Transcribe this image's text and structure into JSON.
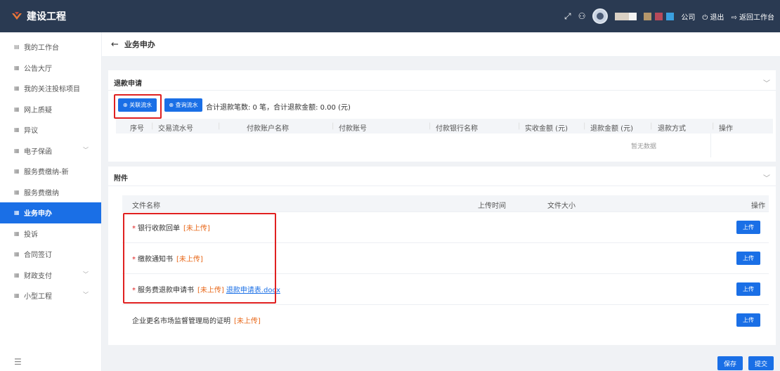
{
  "app": {
    "title": "建设工程"
  },
  "header": {
    "company": "公司",
    "logout": "退出",
    "back_to_workbench": "返回工作台",
    "colors": {
      "bar": "#2a3a52",
      "accent": "#1a6fe6"
    }
  },
  "sidebar": {
    "items": [
      {
        "label": "我的工作台",
        "icon": "workbench-icon"
      },
      {
        "label": "公告大厅",
        "icon": "grid-icon"
      },
      {
        "label": "我的关注投标项目",
        "icon": "grid-icon"
      },
      {
        "label": "网上质疑",
        "icon": "grid-icon"
      },
      {
        "label": "异议",
        "icon": "grid-icon"
      },
      {
        "label": "电子保函",
        "icon": "grid-icon"
      },
      {
        "label": "服务费缴纳-新",
        "icon": "grid-icon"
      },
      {
        "label": "服务费缴纳",
        "icon": "grid-icon"
      },
      {
        "label": "业务申办",
        "icon": "grid-icon"
      },
      {
        "label": "投诉",
        "icon": "grid-icon"
      },
      {
        "label": "合同签订",
        "icon": "grid-icon"
      },
      {
        "label": "财政支付",
        "icon": "grid-icon"
      },
      {
        "label": "小型工程",
        "icon": "grid-icon"
      }
    ]
  },
  "breadcrumb": {
    "title": "业务申办"
  },
  "refund": {
    "title": "退款申请",
    "link_button": "关联流水",
    "query_button": "查询流水",
    "summary": "合计退款笔数: 0 笔，合计退款金额: 0.00 (元)",
    "columns": [
      "序号",
      "交易流水号",
      "付款账户名称",
      "付款账号",
      "付款银行名称",
      "实收金额 (元)",
      "退款金额 (元)",
      "退款方式",
      "操作"
    ],
    "empty": "暂无数据"
  },
  "attachments": {
    "title": "附件",
    "columns": {
      "name": "文件名称",
      "upload_time": "上传时间",
      "size": "文件大小",
      "action": "操作"
    },
    "rows": [
      {
        "required": "*",
        "name": "银行收款回单",
        "status": "[未上传]",
        "file": "",
        "button": "上传"
      },
      {
        "required": "*",
        "name": "缴款通知书",
        "status": "[未上传]",
        "file": "",
        "button": "上传"
      },
      {
        "required": "*",
        "name": "服务费退款申请书",
        "status": "[未上传]",
        "file": "退款申请表.docx",
        "button": "上传"
      },
      {
        "required": "",
        "name": "企业更名市场监督管理局的证明",
        "status": "[未上传]",
        "file": "",
        "button": "上传"
      }
    ]
  },
  "footer": {
    "save": "保存",
    "submit": "提交"
  }
}
